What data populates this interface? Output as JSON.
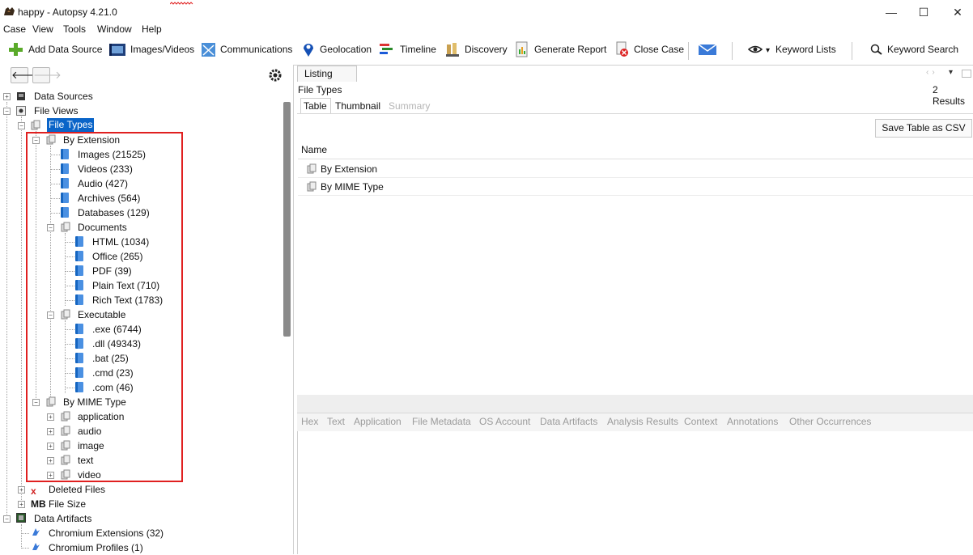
{
  "window": {
    "title": "happy - Autopsy 4.21.0",
    "minimize": "—",
    "maximize": "☐",
    "close": "✕"
  },
  "menu": [
    "Case",
    "View",
    "Tools",
    "Window",
    "Help"
  ],
  "toolbar": {
    "add_data_source": "Add Data Source",
    "images_videos": "Images/Videos",
    "communications": "Communications",
    "geolocation": "Geolocation",
    "timeline": "Timeline",
    "discovery": "Discovery",
    "generate_report": "Generate Report",
    "close_case": "Close Case",
    "keyword_lists": "Keyword Lists",
    "keyword_search": "Keyword Search"
  },
  "tree": {
    "data_sources": "Data Sources",
    "file_views": "File Views",
    "file_types": "File Types",
    "by_extension": "By Extension",
    "ext_items": [
      "Images (21525)",
      "Videos (233)",
      "Audio (427)",
      "Archives (564)",
      "Databases (129)"
    ],
    "documents": "Documents",
    "doc_items": [
      "HTML (1034)",
      "Office (265)",
      "PDF (39)",
      "Plain Text (710)",
      "Rich Text (1783)"
    ],
    "executable": "Executable",
    "exe_items": [
      ".exe (6744)",
      ".dll (49343)",
      ".bat (25)",
      ".cmd (23)",
      ".com (46)"
    ],
    "by_mime": "By MIME Type",
    "mime_items": [
      "application",
      "audio",
      "image",
      "text",
      "video"
    ],
    "deleted_files": "Deleted Files",
    "mb_label": "MB",
    "file_size": "File Size",
    "data_artifacts": "Data Artifacts",
    "chromium_extensions": "Chromium Extensions (32)",
    "chromium_profiles": "Chromium Profiles (1)"
  },
  "right": {
    "listing_tab": "Listing",
    "header": "File Types",
    "results": "2  Results",
    "subtabs": [
      "Table",
      "Thumbnail",
      "Summary"
    ],
    "save_table": "Save Table as CSV",
    "col_name": "Name",
    "rows": [
      "By Extension",
      "By MIME Type"
    ]
  },
  "lower_tabs": [
    "Hex",
    "Text",
    "Application",
    "File Metadata",
    "OS Account",
    "Data Artifacts",
    "Analysis Results",
    "Context",
    "Annotations",
    "Other Occurrences"
  ],
  "colors": {
    "highlight": "#e02020",
    "selection": "#0a64c8"
  }
}
